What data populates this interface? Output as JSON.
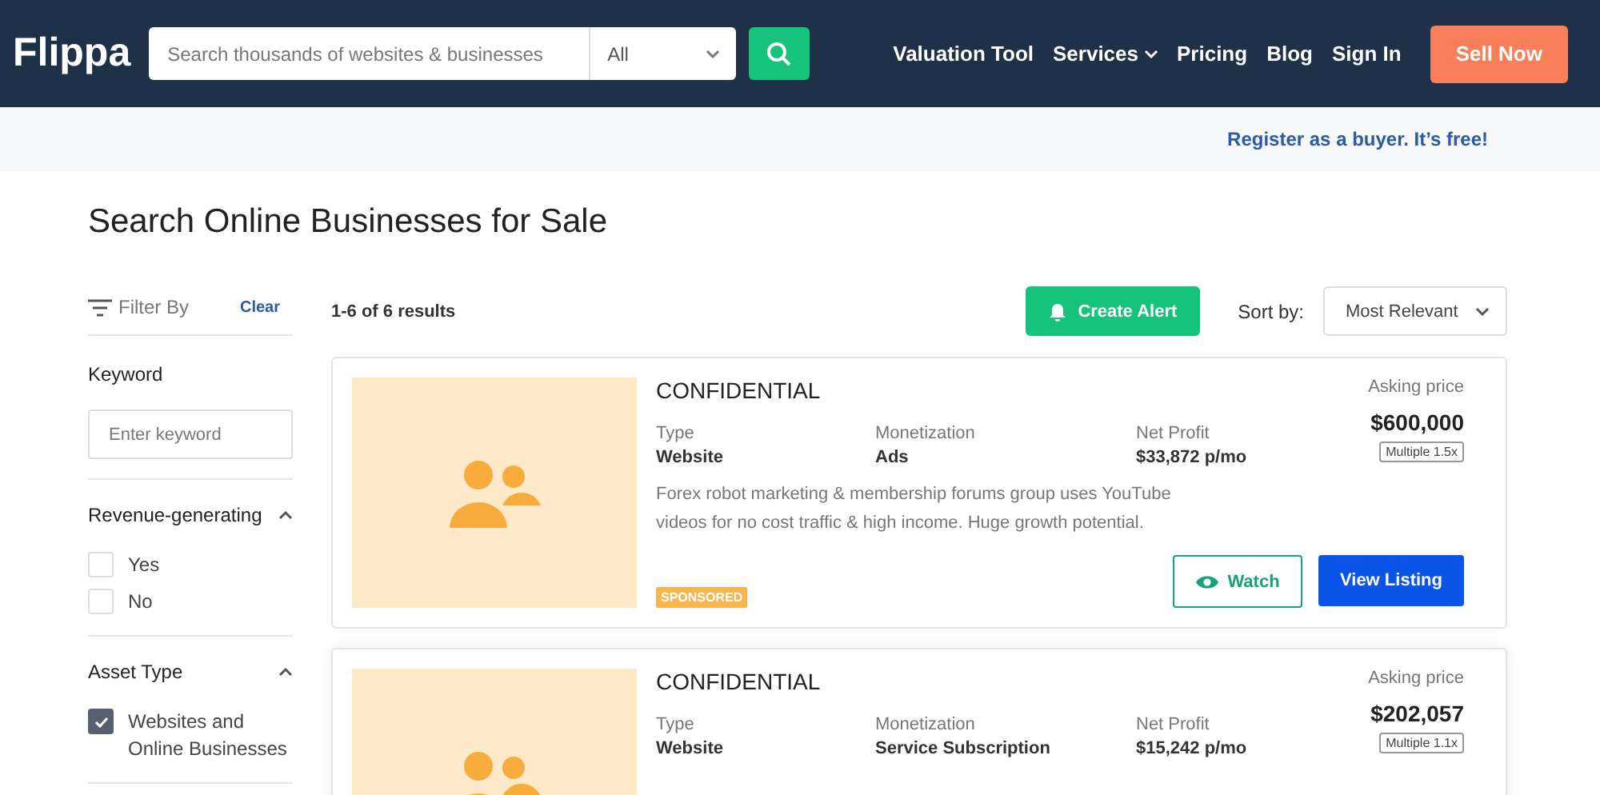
{
  "header": {
    "logo": "Flippa",
    "search": {
      "placeholder": "Search thousands of websites & businesses"
    },
    "category": {
      "value": "All"
    },
    "nav": [
      {
        "label": "Valuation Tool",
        "dropdown": false
      },
      {
        "label": "Services",
        "dropdown": true
      },
      {
        "label": "Pricing",
        "dropdown": false
      },
      {
        "label": "Blog",
        "dropdown": false
      },
      {
        "label": "Sign In",
        "dropdown": false
      }
    ],
    "cta": "Sell Now"
  },
  "register_link": "Register as a buyer. It’s free!",
  "page_title": "Search Online Businesses for Sale",
  "filters": {
    "title": "Filter By",
    "clear": "Clear",
    "keyword": {
      "label": "Keyword",
      "placeholder": "Enter keyword"
    },
    "sections": [
      {
        "title": "Revenue-generating",
        "expanded": true,
        "options": [
          {
            "label": "Yes",
            "checked": false
          },
          {
            "label": "No",
            "checked": false
          }
        ]
      },
      {
        "title": "Asset Type",
        "expanded": true,
        "options": [
          {
            "label": "Websites and Online Businesses",
            "checked": true
          }
        ]
      }
    ]
  },
  "results": {
    "count": "1-6 of 6 results",
    "create_alert": "Create Alert",
    "sort_label": "Sort by:",
    "sort_value": "Most Relevant"
  },
  "listings": [
    {
      "title": "CONFIDENTIAL",
      "columns": [
        {
          "label": "Type",
          "value": "Website"
        },
        {
          "label": "Monetization",
          "value": "Ads"
        },
        {
          "label": "Net Profit",
          "value": "$33,872 p/mo"
        }
      ],
      "asking_label": "Asking price",
      "price": "$600,000",
      "multiple": "Multiple 1.5x",
      "description": "Forex robot marketing & membership forums group uses YouTube videos for no cost traffic & high income. Huge growth potential.",
      "badge": "SPONSORED",
      "watch": "Watch",
      "view": "View Listing"
    },
    {
      "title": "CONFIDENTIAL",
      "columns": [
        {
          "label": "Type",
          "value": "Website"
        },
        {
          "label": "Monetization",
          "value": "Service Subscription"
        },
        {
          "label": "Net Profit",
          "value": "$15,242 p/mo"
        }
      ],
      "asking_label": "Asking price",
      "price": "$202,057",
      "multiple": "Multiple 1.1x"
    }
  ]
}
